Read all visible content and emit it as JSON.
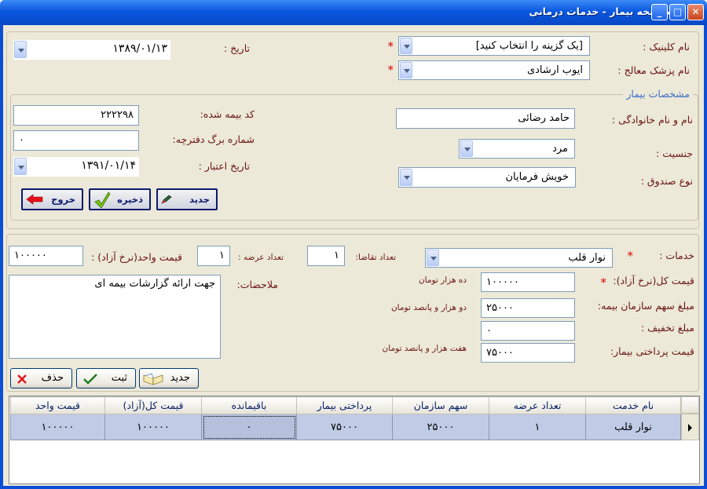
{
  "window": {
    "title": "ثبت نسخه بیمار -  خدمات درمانی",
    "controls": {
      "minimize": "_",
      "maximize": "□",
      "close": "✕"
    }
  },
  "top": {
    "clinic_label": "نام کلینیک :",
    "clinic_value": "[یک گزینه را انتخاب کنید]",
    "doctor_label": "نام پزشک معالج :",
    "doctor_value": "ایوب ارشادی",
    "date_label": "تاریخ :",
    "date_value": "۱۳۸۹/۰۱/۱۳",
    "required": "*"
  },
  "patient": {
    "section_title": "مشخصات بیمار",
    "name_label": "نام و نام خانوادگی :",
    "name_value": "حامد رضائی",
    "gender_label": "جنسیت :",
    "gender_value": "مرد",
    "fund_label": "نوع صندوق :",
    "fund_value": "خویش فرمایان",
    "insurance_code_label": "کد بیمه شده:",
    "insurance_code_value": "۲۲۲۲۹۸",
    "booklet_label": "شماره برگ دفترچه:",
    "booklet_value": "۰",
    "validity_label": "تاریخ اعتبار :",
    "validity_value": "۱۳۹۱/۰۱/۱۴"
  },
  "actions": {
    "new": "جدید",
    "save": "ذخیره",
    "exit": "خروج"
  },
  "services": {
    "service_label": "خدمات :",
    "service_value": "نوار قلب",
    "request_count_label": "تعداد تقاضا:",
    "request_count_value": "۱",
    "supply_count_label": "تعداد عرضه :",
    "supply_count_value": "۱",
    "unit_price_label": "قیمت واحد(نرخ آزاد) :",
    "unit_price_value": "۱۰۰۰۰۰",
    "total_price_label": "قیمت کل(نرخ آزاد):",
    "total_price_value": "۱۰۰۰۰۰",
    "total_price_words": "ده هزار  تومان",
    "insurance_share_label": "مبلغ سهم سازمان بیمه:",
    "insurance_share_value": "۲۵۰۰۰",
    "insurance_share_words": "دو هزار و پانصد  تومان",
    "discount_label": "مبلغ تخفیف :",
    "discount_value": "۰",
    "patient_pay_label": "قیمت پرداختی بیمار:",
    "patient_pay_value": "۷۵۰۰۰",
    "patient_pay_words": "هفت هزار و پانصد  تومان",
    "notes_label": "ملاحضات:",
    "notes_value": "جهت ارائه گزارشات بیمه ای"
  },
  "row_actions": {
    "new": "جدید",
    "register": "ثبت",
    "delete": "حذف"
  },
  "table": {
    "columns": [
      "نام خدمت",
      "تعداد عرضه",
      "سهم سازمان",
      "پرداختی بیمار",
      "باقیمانده",
      "قیمت کل(آزاد)",
      "قیمت واحد"
    ],
    "rows": [
      [
        "نوار قلب",
        "۱",
        "۲۵۰۰۰",
        "۷۵۰۰۰",
        "۰",
        "۱۰۰۰۰۰",
        "۱۰۰۰۰۰"
      ]
    ]
  },
  "colors": {
    "titlebar": "#0a57e0",
    "form_bg": "#ece9d8",
    "label_brown": "#6b1414",
    "required_red": "#dd0000",
    "grid_row": "#c0cbe6"
  }
}
